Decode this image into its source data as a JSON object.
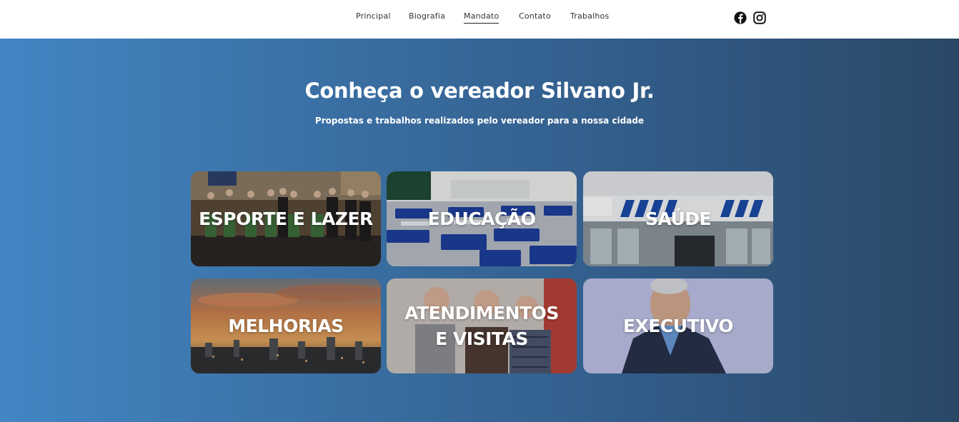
{
  "nav": {
    "items": [
      {
        "label": "Principal"
      },
      {
        "label": "Biografia"
      },
      {
        "label": "Mandato"
      },
      {
        "label": "Contato"
      },
      {
        "label": "Trabalhos"
      }
    ],
    "active": "Mandato"
  },
  "social": {
    "icons": [
      "facebook-icon",
      "instagram-icon"
    ]
  },
  "hero": {
    "title": "Conheça o vereador Silvano Jr.",
    "subtitle": "Propostas e trabalhos realizados pelo vereador para a nossa cidade"
  },
  "cards": [
    {
      "label": "ESPORTE E LAZER"
    },
    {
      "label": "EDUCAÇÃO"
    },
    {
      "label": "SAÚDE"
    },
    {
      "label": "MELHORIAS"
    },
    {
      "label_line1": "ATENDIMENTOS",
      "label_line2": "E VISITAS"
    },
    {
      "label": "EXECUTIVO"
    }
  ],
  "colors": {
    "hero_gradient_start": "#4286c4",
    "hero_gradient_end": "#2a4866",
    "text_on_hero": "#ffffff",
    "nav_text": "#333333"
  }
}
